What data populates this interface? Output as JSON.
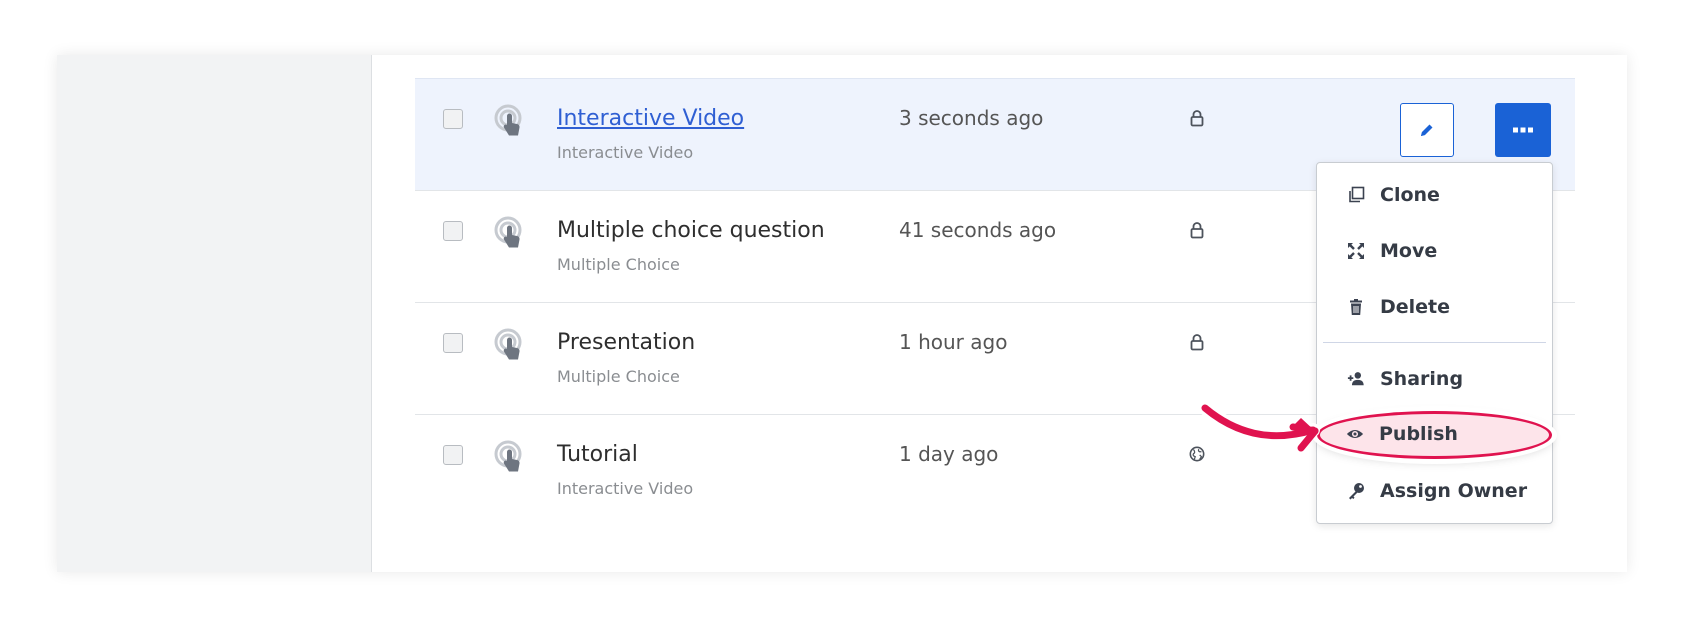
{
  "rows": [
    {
      "title": "Interactive Video",
      "subtitle": "Interactive Video",
      "time": "3 seconds ago",
      "access": "lock-icon"
    },
    {
      "title": "Multiple choice question",
      "subtitle": "Multiple Choice",
      "time": "41 seconds ago",
      "access": "lock-icon"
    },
    {
      "title": "Presentation",
      "subtitle": "Multiple Choice",
      "time": "1 hour ago",
      "access": "lock-icon"
    },
    {
      "title": "Tutorial",
      "subtitle": "Interactive Video",
      "time": "1 day ago",
      "access": "globe-icon"
    }
  ],
  "menu": {
    "items": [
      {
        "label": "Clone",
        "icon": "clone-icon"
      },
      {
        "label": "Move",
        "icon": "move-icon"
      },
      {
        "label": "Delete",
        "icon": "trash-icon"
      },
      {
        "label": "Sharing",
        "icon": "add-user-icon"
      },
      {
        "label": "Publish",
        "icon": "eye-icon"
      },
      {
        "label": "Assign Owner",
        "icon": "key-icon"
      }
    ]
  },
  "colors": {
    "accent": "#1a62d6",
    "highlight": "#e0134f",
    "selected_row": "#eef3fd",
    "sidebar": "#f2f3f4"
  }
}
